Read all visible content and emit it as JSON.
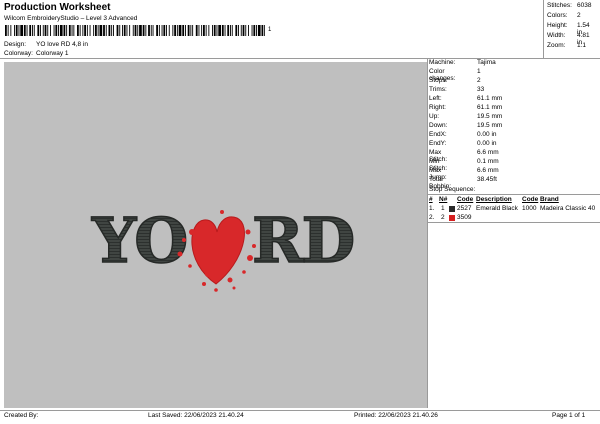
{
  "header": {
    "title": "Production Worksheet",
    "subtitle": "Wilcom EmbroideryStudio – Level 3 Advanced",
    "barcode_text": "1"
  },
  "design_info": [
    {
      "label": "Design:",
      "value": "YO love RD 4,8 in"
    },
    {
      "label": "Colorway:",
      "value": "Colorway 1"
    }
  ],
  "summary": [
    {
      "label": "Stitches:",
      "value": "6038"
    },
    {
      "label": "Colors:",
      "value": "2"
    },
    {
      "label": "Height:",
      "value": "1.54 in"
    },
    {
      "label": "Width:",
      "value": "4.81 in"
    },
    {
      "label": "Zoom:",
      "value": "1:1"
    }
  ],
  "properties": [
    {
      "label": "Machine:",
      "value": "Tajima"
    },
    {
      "label": "Color changes:",
      "value": "1"
    },
    {
      "label": "Stops:",
      "value": "2"
    },
    {
      "label": "Trims:",
      "value": "33"
    },
    {
      "label": "Left:",
      "value": "61.1 mm"
    },
    {
      "label": "Right:",
      "value": "61.1 mm"
    },
    {
      "label": "Up:",
      "value": "19.5 mm"
    },
    {
      "label": "Down:",
      "value": "19.5 mm"
    },
    {
      "label": "EndX:",
      "value": "0.00 in"
    },
    {
      "label": "EndY:",
      "value": "0.00 in"
    },
    {
      "label": "Max Stitch:",
      "value": "6.6 mm"
    },
    {
      "label": "Min Stitch:",
      "value": "0.1 mm"
    },
    {
      "label": "Max Jump:",
      "value": "6.6 mm"
    },
    {
      "label": "Total Bobbin:",
      "value": "38.45ft"
    }
  ],
  "stop_sequence": {
    "title": "Stop Sequence:",
    "columns": [
      "#",
      "N#",
      "Code",
      "Description",
      "Code",
      "Brand"
    ],
    "rows": [
      {
        "index": "1.",
        "needle": "1",
        "color": "#2b2b2b",
        "code": "2527",
        "description": "Emerald Black",
        "code2": "1000",
        "brand": "Madeira Classic 40"
      },
      {
        "index": "2.",
        "needle": "2",
        "color": "#d62020",
        "code": "3509",
        "description": "",
        "code2": "",
        "brand": ""
      }
    ]
  },
  "design_preview": {
    "left_text": "YO",
    "right_text": "RD",
    "letter_color": "#3a3f3c",
    "heart_color": "#d8282a",
    "background": "#bfbfbf"
  },
  "footer": {
    "created_by": "Created By:",
    "last_saved": "Last Saved: 22/06/2023 21.40.24",
    "printed": "Printed: 22/06/2023 21.40.26",
    "page": "Page 1 of 1"
  }
}
